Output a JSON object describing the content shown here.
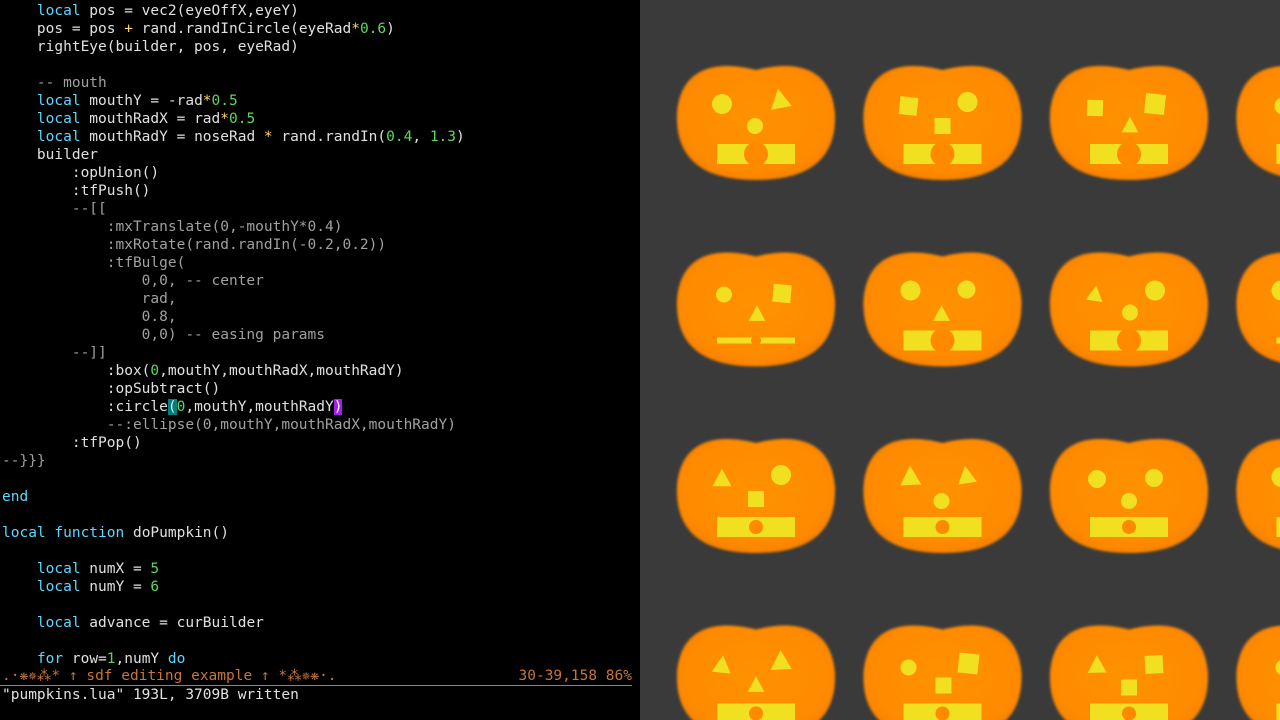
{
  "editor": {
    "lines": [
      [
        {
          "t": "    "
        },
        {
          "t": "local",
          "c": "kw"
        },
        {
          "t": " pos = vec2(eyeOffX,eyeY)"
        }
      ],
      [
        {
          "t": "    pos = pos "
        },
        {
          "t": "+",
          "c": "op"
        },
        {
          "t": " rand.randInCircle(eyeRad"
        },
        {
          "t": "*",
          "c": "op"
        },
        {
          "t": "0.6",
          "c": "num"
        },
        {
          "t": ")"
        }
      ],
      [
        {
          "t": "    rightEye(builder, pos, eyeRad)"
        }
      ],
      [
        {
          "t": ""
        }
      ],
      [
        {
          "t": "    -- mouth",
          "c": "cm"
        }
      ],
      [
        {
          "t": "    "
        },
        {
          "t": "local",
          "c": "kw"
        },
        {
          "t": " mouthY = -rad"
        },
        {
          "t": "*",
          "c": "op"
        },
        {
          "t": "0.5",
          "c": "num"
        }
      ],
      [
        {
          "t": "    "
        },
        {
          "t": "local",
          "c": "kw"
        },
        {
          "t": " mouthRadX = rad"
        },
        {
          "t": "*",
          "c": "op"
        },
        {
          "t": "0.5",
          "c": "num"
        }
      ],
      [
        {
          "t": "    "
        },
        {
          "t": "local",
          "c": "kw"
        },
        {
          "t": " mouthRadY = noseRad "
        },
        {
          "t": "*",
          "c": "op"
        },
        {
          "t": " rand.randIn("
        },
        {
          "t": "0.4",
          "c": "num"
        },
        {
          "t": ", "
        },
        {
          "t": "1.3",
          "c": "num"
        },
        {
          "t": ")"
        }
      ],
      [
        {
          "t": "    builder"
        }
      ],
      [
        {
          "t": "        :opUnion()"
        }
      ],
      [
        {
          "t": "        :tfPush()"
        }
      ],
      [
        {
          "t": "        --[[",
          "c": "cm"
        }
      ],
      [
        {
          "t": "            :mxTranslate(0,-mouthY*0.4)",
          "c": "cm"
        }
      ],
      [
        {
          "t": "            :mxRotate(rand.randIn(-0.2,0.2))",
          "c": "cm"
        }
      ],
      [
        {
          "t": "            :tfBulge(",
          "c": "cm"
        }
      ],
      [
        {
          "t": "                0,0, -- center",
          "c": "cm"
        }
      ],
      [
        {
          "t": "                rad,",
          "c": "cm"
        }
      ],
      [
        {
          "t": "                0.8,",
          "c": "cm"
        }
      ],
      [
        {
          "t": "                0,0) -- easing params",
          "c": "cm"
        }
      ],
      [
        {
          "t": "        --]]",
          "c": "cm"
        }
      ],
      [
        {
          "t": "            :box("
        },
        {
          "t": "0",
          "c": "num"
        },
        {
          "t": ",mouthY,mouthRadX,mouthRadY)"
        }
      ],
      [
        {
          "t": "            :opSubtract()"
        }
      ],
      [
        {
          "t": "            :circle"
        },
        {
          "t": "(",
          "c": "cur-bracket"
        },
        {
          "t": "0",
          "c": "num"
        },
        {
          "t": ",mouthY,mouthRadY"
        },
        {
          "t": ")",
          "c": "cur-paren"
        }
      ],
      [
        {
          "t": "            --:ellipse(0,mouthY,mouthRadX,mouthRadY)",
          "c": "cm"
        }
      ],
      [
        {
          "t": "        :tfPop()"
        }
      ],
      [
        {
          "t": "--}}}",
          "c": "cm"
        }
      ],
      [
        {
          "t": ""
        }
      ],
      [
        {
          "t": "end",
          "c": "kw"
        }
      ],
      [
        {
          "t": ""
        }
      ],
      [
        {
          "t": "local",
          "c": "kw"
        },
        {
          "t": " "
        },
        {
          "t": "function",
          "c": "kw"
        },
        {
          "t": " doPumpkin()"
        }
      ],
      [
        {
          "t": ""
        }
      ],
      [
        {
          "t": "    "
        },
        {
          "t": "local",
          "c": "kw"
        },
        {
          "t": " numX = "
        },
        {
          "t": "5",
          "c": "num"
        }
      ],
      [
        {
          "t": "    "
        },
        {
          "t": "local",
          "c": "kw"
        },
        {
          "t": " numY = "
        },
        {
          "t": "6",
          "c": "num"
        }
      ],
      [
        {
          "t": ""
        }
      ],
      [
        {
          "t": "    "
        },
        {
          "t": "local",
          "c": "kw"
        },
        {
          "t": " advance = curBuilder"
        }
      ],
      [
        {
          "t": ""
        }
      ],
      [
        {
          "t": "    "
        },
        {
          "t": "for",
          "c": "kw"
        },
        {
          "t": " row="
        },
        {
          "t": "1",
          "c": "num"
        },
        {
          "t": ",numY "
        },
        {
          "t": "do",
          "c": "kw"
        }
      ]
    ],
    "status_left": ".·❋✵⁂* ↑ sdf editing example ↑ *⁂✵❋·.",
    "status_right": "30-39,158 86%",
    "message": "\"pumpkins.lua\" 193L, 3709B written"
  },
  "viewport": {
    "background": "#3a3a3a",
    "pumpkin_color": "#ff8c00",
    "feature_color": "#f0e020",
    "pumpkins": [
      {
        "eyes": [
          "circle",
          "triangle"
        ],
        "nose": "circle",
        "mouth": "hole"
      },
      {
        "eyes": [
          "square",
          "circle"
        ],
        "nose": "square",
        "mouth": "hole"
      },
      {
        "eyes": [
          "square",
          "square"
        ],
        "nose": "triangle",
        "mouth": "hole"
      },
      {
        "eyes": [
          "circle",
          "circle"
        ],
        "nose": "circle",
        "mouth": "hole"
      },
      {
        "eyes": [
          "circle",
          "square"
        ],
        "nose": "triangle",
        "mouth": "thin"
      },
      {
        "eyes": [
          "circle",
          "circle"
        ],
        "nose": "triangle",
        "mouth": "hole"
      },
      {
        "eyes": [
          "triangle",
          "circle"
        ],
        "nose": "circle",
        "mouth": "hole"
      },
      {
        "eyes": [
          "circle",
          "circle"
        ],
        "nose": "circle",
        "mouth": "thin"
      },
      {
        "eyes": [
          "triangle",
          "circle"
        ],
        "nose": "square",
        "mouth": "notch"
      },
      {
        "eyes": [
          "triangle",
          "triangle"
        ],
        "nose": "circle",
        "mouth": "notch"
      },
      {
        "eyes": [
          "circle",
          "circle"
        ],
        "nose": "circle",
        "mouth": "notch"
      },
      {
        "eyes": [
          "circle",
          "circle"
        ],
        "nose": "circle",
        "mouth": "notch"
      },
      {
        "eyes": [
          "triangle",
          "triangle"
        ],
        "nose": "triangle",
        "mouth": "notch"
      },
      {
        "eyes": [
          "circle",
          "square"
        ],
        "nose": "square",
        "mouth": "notch"
      },
      {
        "eyes": [
          "triangle",
          "square"
        ],
        "nose": "square",
        "mouth": "notch"
      },
      {
        "eyes": [
          "circle",
          "circle"
        ],
        "nose": "circle",
        "mouth": "notch"
      }
    ]
  }
}
